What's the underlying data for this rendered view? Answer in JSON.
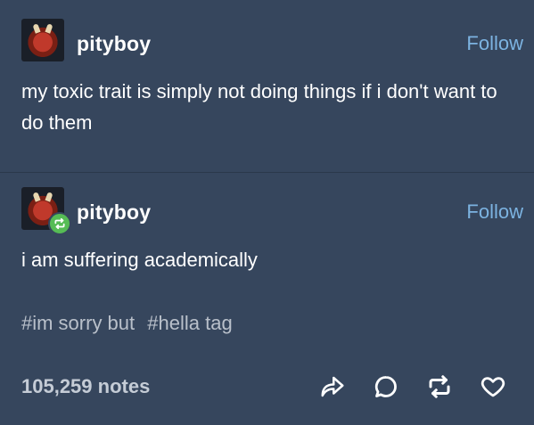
{
  "post1": {
    "username": "pityboy",
    "follow_label": "Follow",
    "text": "my toxic trait is simply not doing things if i don't want to do them"
  },
  "post2": {
    "username": "pityboy",
    "follow_label": "Follow",
    "text": "i am suffering academically",
    "tags": [
      "#im sorry but",
      "#hella tag"
    ],
    "notes": "105,259 notes"
  },
  "icons": {
    "share": "share-icon",
    "reply": "reply-icon",
    "reblog": "reblog-icon",
    "like": "heart-icon"
  },
  "colors": {
    "background": "#36465d",
    "link": "#7cb3e1",
    "reblog_badge": "#56bc55"
  }
}
